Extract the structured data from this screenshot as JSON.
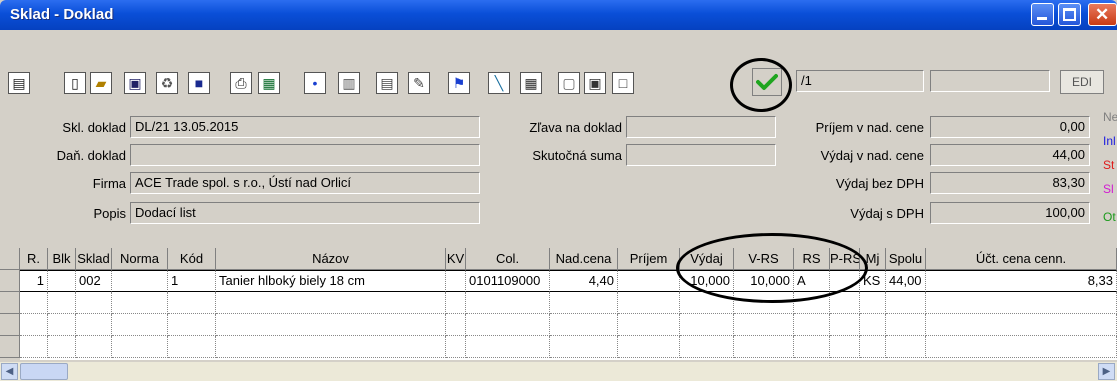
{
  "window": {
    "title": "Sklad - Doklad"
  },
  "toolbar": {
    "doc_counter": "/1",
    "edi_label": "EDI",
    "icons": [
      "print-icon",
      "new-document-icon",
      "open-folder-icon",
      "copy-icon",
      "recycle-bin-icon",
      "monitor-icon",
      "printer-icon",
      "grid-icon",
      "dot-icon",
      "list-icon",
      "ledger-icon",
      "edit-icon",
      "forklift-icon",
      "wand-icon",
      "calculator-icon",
      "sign-icon",
      "copy2-icon",
      "page-icon"
    ],
    "confirm_icon": "checkmark-icon"
  },
  "form": {
    "skl_doklad_label": "Skl. doklad",
    "skl_doklad_value": "DL/21 13.05.2015",
    "dan_doklad_label": "Daň. doklad",
    "dan_doklad_value": "",
    "firma_label": "Firma",
    "firma_value": "ACE Trade spol. s r.o., Ústí nad Orlicí",
    "popis_label": "Popis",
    "popis_value": "Dodací list",
    "zlava_label": "Zľava na doklad",
    "zlava_value": "",
    "skutocna_label": "Skutočná suma",
    "skutocna_value": "",
    "prijem_nad_label": "Príjem v nad. cene",
    "prijem_nad_value": "0,00",
    "vydaj_nad_label": "Výdaj v nad. cene",
    "vydaj_nad_value": "44,00",
    "vydaj_bez_label": "Výdaj bez DPH",
    "vydaj_bez_value": "83,30",
    "vydaj_s_label": "Výdaj s DPH",
    "vydaj_s_value": "100,00"
  },
  "legend": [
    {
      "text": "Ne",
      "color": "#808080"
    },
    {
      "text": "Inl",
      "color": "#1a1ae0"
    },
    {
      "text": "St",
      "color": "#e01a1a"
    },
    {
      "text": "Sl",
      "color": "#d21ad2"
    },
    {
      "text": "Ot",
      "color": "#1a9a1a"
    }
  ],
  "grid": {
    "headers": [
      "R.",
      "Blk",
      "Sklad",
      "Norma",
      "Kód",
      "Názov",
      "KV",
      "Col.",
      "Nad.cena",
      "Príjem",
      "Výdaj",
      "V-RS",
      "RS",
      "P-RS",
      "Mj",
      "Spolu",
      "Účt. cena cenn."
    ],
    "rows": [
      [
        "1",
        "",
        "002",
        "",
        "1",
        "Tanier hlboký biely 18 cm",
        "",
        "0101109000",
        "4,40",
        "",
        "10,000",
        "10,000",
        "A",
        "",
        "KS",
        "44,00",
        "8,33"
      ]
    ]
  },
  "colors": {
    "title_bar": "#0a4fd8",
    "window_bg": "#d4d0c8",
    "confirm_green": "#1fa51f"
  }
}
